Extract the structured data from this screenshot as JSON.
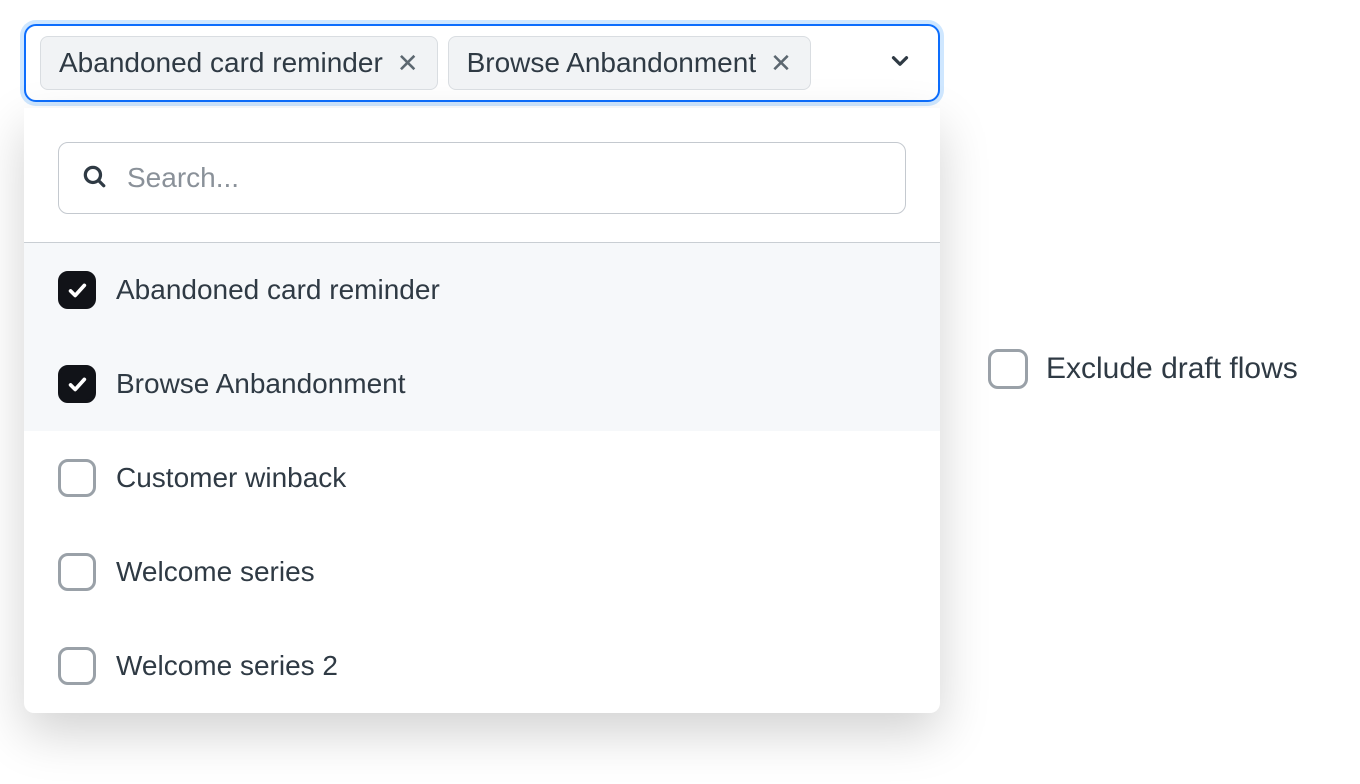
{
  "multiselect": {
    "chips": [
      {
        "label": "Abandoned card reminder"
      },
      {
        "label": "Browse Anbandonment"
      }
    ],
    "search_placeholder": "Search...",
    "options": [
      {
        "label": "Abandoned card reminder",
        "selected": true
      },
      {
        "label": "Browse Anbandonment",
        "selected": true
      },
      {
        "label": "Customer winback",
        "selected": false
      },
      {
        "label": "Welcome series",
        "selected": false
      },
      {
        "label": "Welcome series 2",
        "selected": false
      }
    ]
  },
  "exclude": {
    "label": "Exclude draft flows",
    "checked": false
  }
}
